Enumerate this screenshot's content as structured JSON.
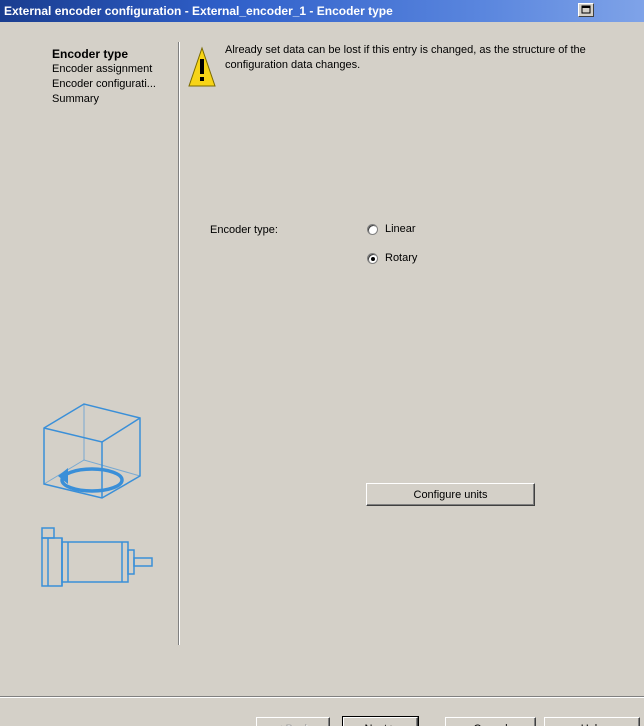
{
  "window": {
    "title": "External encoder configuration - External_encoder_1 - Encoder type"
  },
  "nav": {
    "items": [
      {
        "label": "Encoder type",
        "active": true
      },
      {
        "label": "Encoder assignment",
        "active": false
      },
      {
        "label": "Encoder configurati...",
        "active": false
      },
      {
        "label": "Summary",
        "active": false
      }
    ]
  },
  "warning": {
    "icon": "warning-icon",
    "text": "Already set data can be lost if this entry is changed, as the structure of the configuration data changes."
  },
  "encoder_type": {
    "label": "Encoder type:",
    "options": [
      {
        "label": "Linear",
        "checked": false
      },
      {
        "label": "Rotary",
        "checked": true
      }
    ]
  },
  "buttons": {
    "configure_units": "Configure units",
    "back": "< Back",
    "next": "Next >",
    "cancel": "Cancel",
    "help": "Help"
  },
  "colors": {
    "illustration": "#3a8fd8",
    "dialog_bg": "#d4d0c8"
  }
}
